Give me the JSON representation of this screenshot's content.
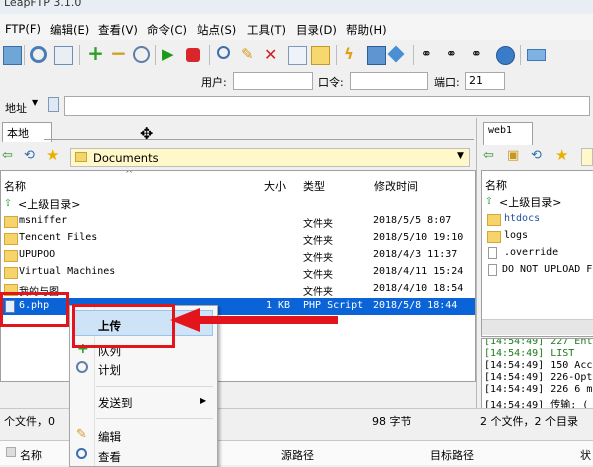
{
  "window": {
    "title": "LeapFTP 3.1.0"
  },
  "menu": [
    "FTP(F)",
    "编辑(E)",
    "查看(V)",
    "命令(C)",
    "站点(S)",
    "工具(T)",
    "目录(D)",
    "帮助(H)"
  ],
  "connection": {
    "user_label": "用户:",
    "pass_label": "口令:",
    "port_label": "端口:",
    "port_value": "21"
  },
  "address": {
    "label": "地址"
  },
  "local": {
    "tab": "本地",
    "path": "Documents",
    "columns": [
      "名称",
      "大小",
      "类型",
      "修改时间"
    ],
    "parent": "<上级目录>",
    "rows": [
      {
        "name": "msniffer",
        "size": "",
        "type": "文件夹",
        "date": "2018/5/5 8:07"
      },
      {
        "name": "Tencent Files",
        "size": "",
        "type": "文件夹",
        "date": "2018/5/10 19:10"
      },
      {
        "name": "UPUPOO",
        "size": "",
        "type": "文件夹",
        "date": "2018/4/3 11:37"
      },
      {
        "name": "Virtual Machines",
        "size": "",
        "type": "文件夹",
        "date": "2018/4/11 15:24"
      },
      {
        "name": "我的与图",
        "size": "",
        "type": "文件夹",
        "date": "2018/4/10 18:54"
      },
      {
        "name": "6.php",
        "size": "1 KB",
        "type": "PHP Script",
        "date": "2018/5/8 18:44"
      }
    ],
    "status_left": "个文件，0",
    "status_right": "98 字节"
  },
  "remote": {
    "tab": "web1",
    "columns": [
      "名称"
    ],
    "parent": "<上级目录>",
    "rows": [
      "htdocs",
      "logs",
      ".override",
      "DO NOT UPLOAD F"
    ],
    "log": [
      "[14:54:49] 227 Ent",
      "[14:54:49] LIST",
      "[14:54:49] 150 Acc",
      "[14:54:49] 226-Opt",
      "[14:54:49] 226 6 m",
      "[14:54:49] 传输: (",
      "[14:54:49]"
    ],
    "status": "2 个文件，2 个目录"
  },
  "context_menu": {
    "upload": "上传",
    "queue": "队列",
    "schedule": "计划",
    "send_to": "发送到",
    "edit": "编辑",
    "view": "查看"
  },
  "queue": {
    "columns": [
      "名称",
      "源路径",
      "目标路径",
      "状"
    ]
  },
  "colors": {
    "selection": "#0a64d8",
    "highlight": "#e3141c",
    "combo": "#fff8c8"
  }
}
